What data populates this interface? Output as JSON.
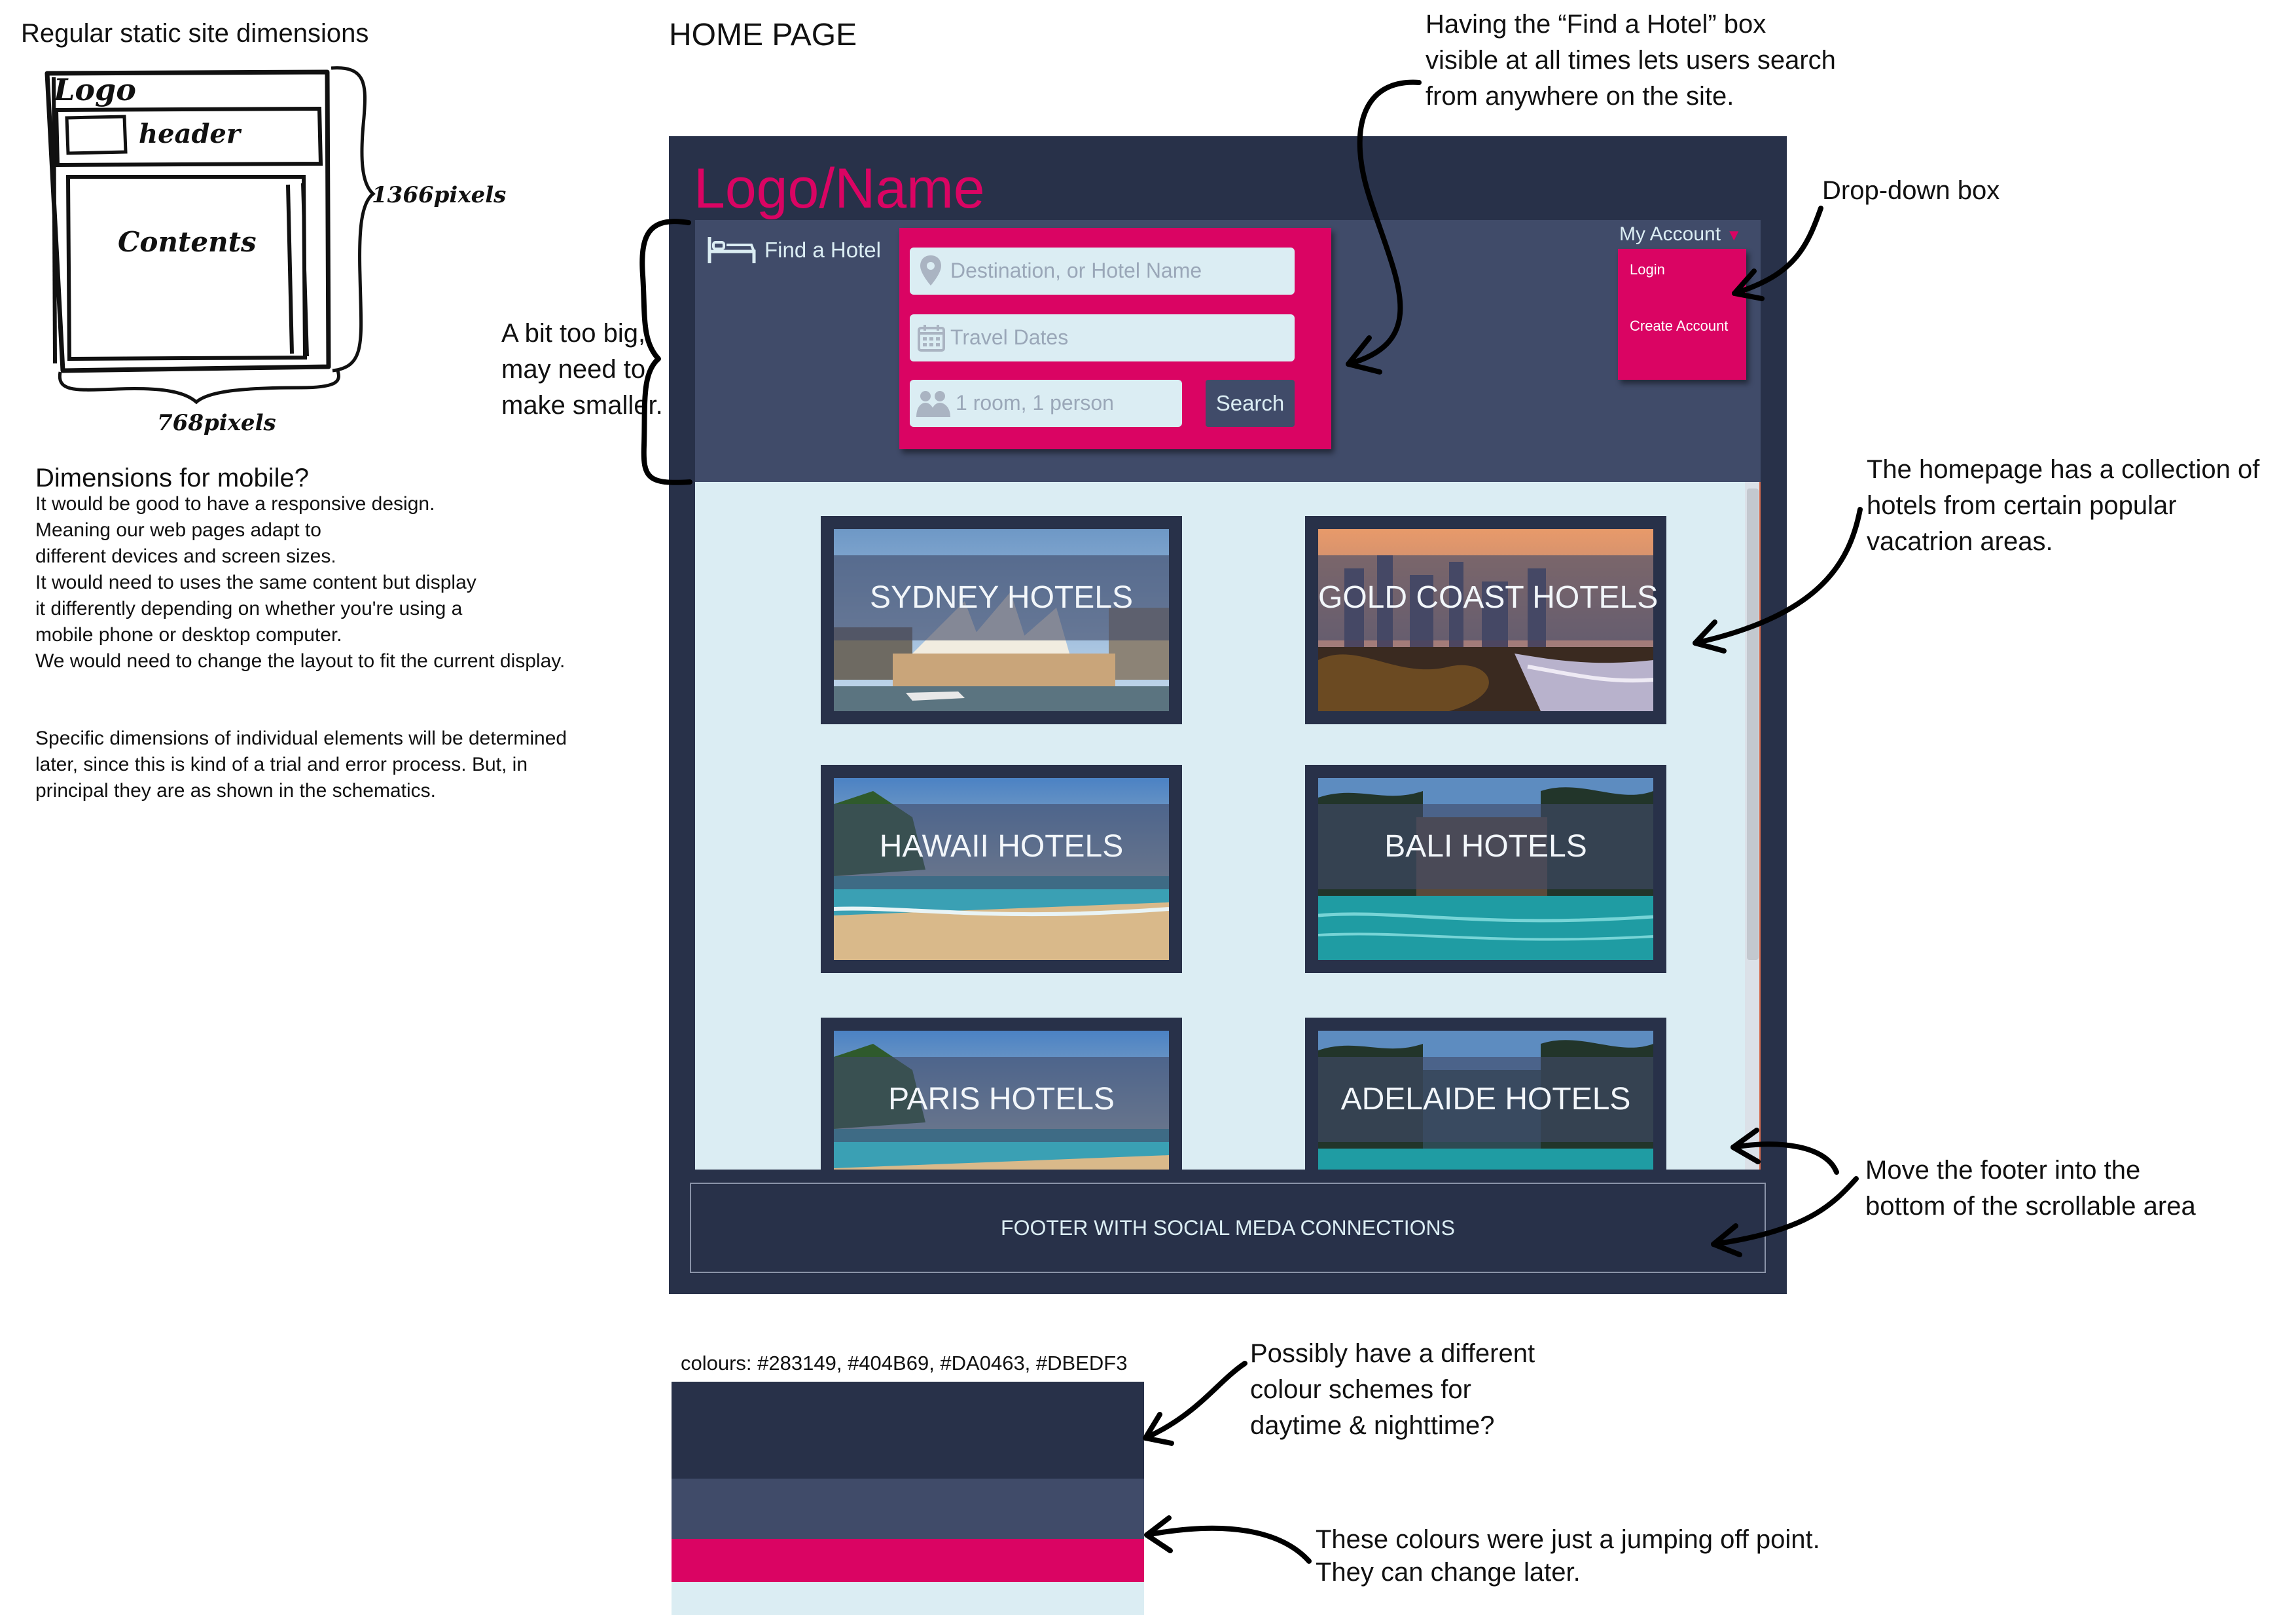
{
  "left_notes": {
    "title": "Regular static site dimensions",
    "sketch_logo": "Logo",
    "sketch_header": "header",
    "sketch_contents": "Contents",
    "sketch_height": "1366pixels",
    "sketch_width": "768pixels",
    "mobile_heading": "Dimensions for mobile?",
    "mobile_lines": [
      "It would be good to have a responsive design.",
      "Meaning our web pages adapt to",
      "different devices and screen sizes.",
      "It would need to uses the same content but display",
      "it differently depending on whether you're using a",
      "mobile phone or desktop computer.",
      "We would need to change the layout to fit the current display."
    ],
    "specific_lines": [
      "Specific dimensions of individual elements will be determined",
      "later, since this is kind of a trial and error process. But, in",
      "principal they are as shown in the schematics."
    ]
  },
  "page_heading": "HOME PAGE",
  "annotations": {
    "find_box": [
      "Having the “Find a Hotel” box",
      "visible at all times lets users search",
      "from anywhere on the site."
    ],
    "too_big": [
      "A bit too big,",
      "may need to",
      "make smaller."
    ],
    "dropdown": [
      "Drop-down box"
    ],
    "collection": [
      "The homepage has a collection of",
      "hotels from certain popular",
      "vacatrion areas."
    ],
    "footer_move": [
      "Move the footer into the",
      "bottom of the scrollable area"
    ],
    "colour_scheme": [
      "Possibly have a different",
      "colour schemes for",
      "daytime & nighttime?"
    ],
    "jumping_off": [
      "These colours were just a jumping off point.",
      "They can change later."
    ]
  },
  "mockup": {
    "logo": "Logo/Name",
    "find_hotel_label": "Find a Hotel",
    "search": {
      "destination_placeholder": "Destination, or Hotel Name",
      "dates_placeholder": "Travel Dates",
      "guests_placeholder": "1 room, 1 person",
      "button_label": "Search"
    },
    "account": {
      "label": "My Account",
      "items": [
        "Login",
        "Create Account"
      ]
    },
    "hotels": [
      "SYDNEY HOTELS",
      "GOLD COAST HOTELS",
      "HAWAII HOTELS",
      "BALI HOTELS",
      "PARIS HOTELS",
      "ADELAIDE HOTELS"
    ],
    "footer": "FOOTER WITH SOCIAL MEDA CONNECTIONS"
  },
  "palette": {
    "label": "colours: #283149, #404B69, #DA0463, #DBEDF3",
    "colors": [
      "#283149",
      "#404B69",
      "#DA0463",
      "#DBEDF3"
    ]
  }
}
